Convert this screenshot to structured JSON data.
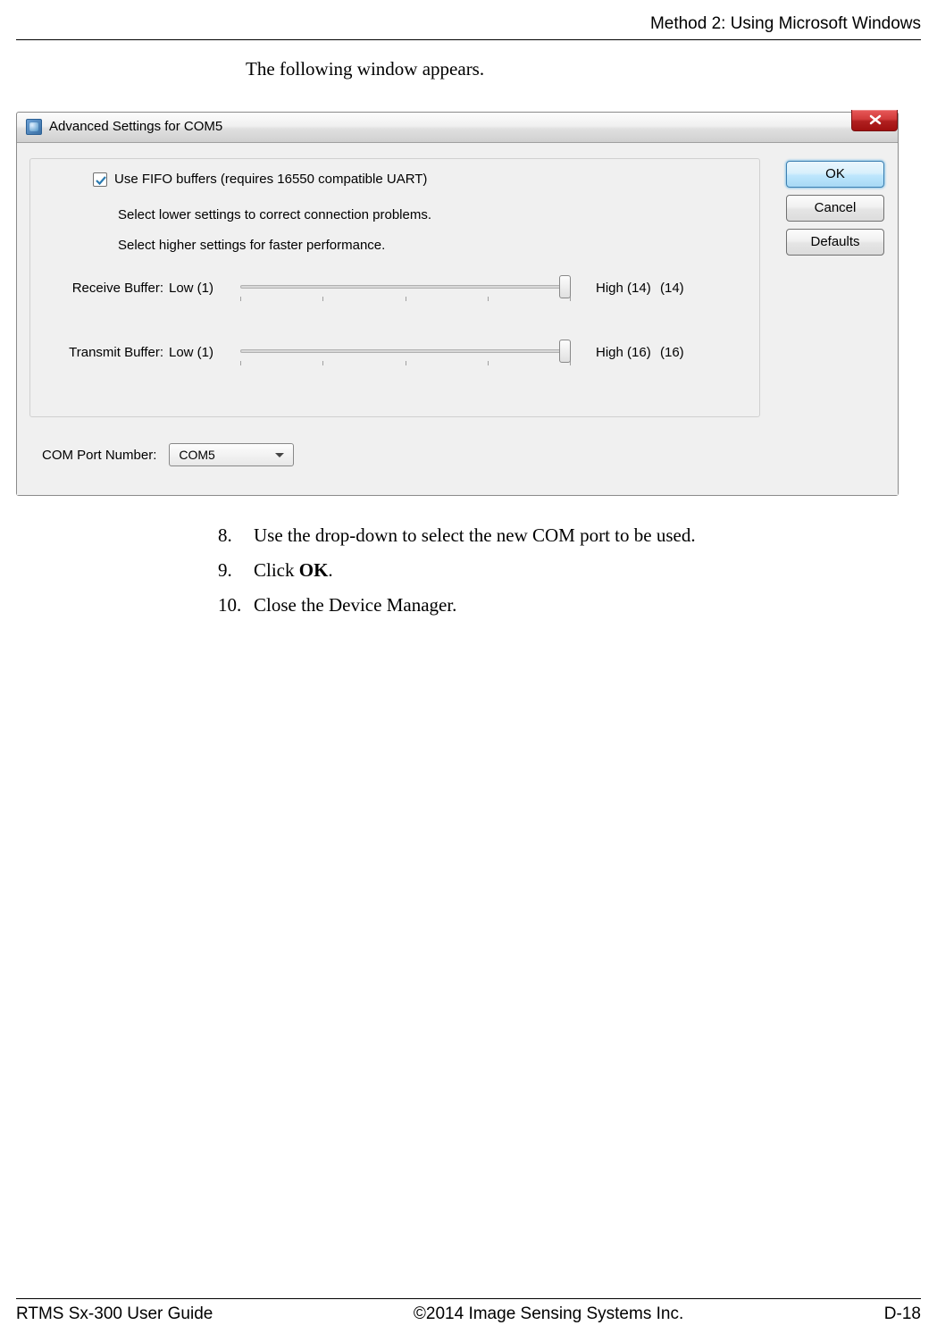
{
  "header": {
    "section_title": "Method 2: Using Microsoft Windows"
  },
  "intro": "The following window appears.",
  "window": {
    "title": "Advanced Settings for COM5",
    "close_label": "x",
    "fifo_checkbox_label": "Use FIFO buffers (requires 16550 compatible UART)",
    "helper1": "Select lower settings to correct connection problems.",
    "helper2": "Select higher settings for faster performance.",
    "receive": {
      "label": "Receive Buffer:",
      "low": "Low (1)",
      "high": "High (14)",
      "value": "(14)"
    },
    "transmit": {
      "label": "Transmit Buffer:",
      "low": "Low (1)",
      "high": "High (16)",
      "value": "(16)"
    },
    "com_label": "COM Port Number:",
    "com_value": "COM5",
    "buttons": {
      "ok": "OK",
      "cancel": "Cancel",
      "defaults": "Defaults"
    }
  },
  "steps": {
    "s8_num": "8.",
    "s8": "Use the drop-down to select the new COM port to be used.",
    "s9_num": "9.",
    "s9_pre": "Click ",
    "s9_bold": "OK",
    "s9_post": ".",
    "s10_num": "10.",
    "s10": "Close the Device Manager."
  },
  "footer": {
    "left": "RTMS Sx-300 User Guide",
    "center": "©2014 Image Sensing Systems Inc.",
    "right": "D-18"
  }
}
